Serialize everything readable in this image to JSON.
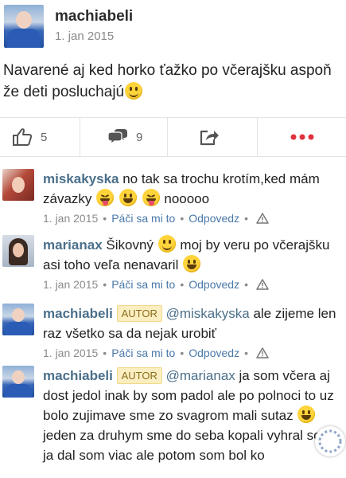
{
  "post": {
    "author": "machiabeli",
    "date": "1. jan 2015",
    "text": "Navarené aj ked horko ťažko po včerajšku aspoň že deti posluchajú"
  },
  "actions": {
    "like_count": "5",
    "comment_count": "9"
  },
  "comments": [
    {
      "author": "miskakyska",
      "text_1": "no tak sa trochu krotím,ked mám závazky",
      "text_2": "nooooo",
      "date": "1. jan 2015",
      "like_label": "Páči sa mi to",
      "reply_label": "Odpovedz"
    },
    {
      "author": "marianax",
      "text_1": "Šikovný",
      "text_2": "moj by veru po včerajšku asi toho veľa nenavaril",
      "date": "1. jan 2015",
      "like_label": "Páči sa mi to",
      "reply_label": "Odpovedz"
    },
    {
      "author": "machiabeli",
      "badge": "AUTOR",
      "mention": "@miskakyska",
      "text_1": "ale zijeme len raz všetko sa da nejak urobiť",
      "date": "1. jan 2015",
      "like_label": "Páči sa mi to",
      "reply_label": "Odpovedz"
    },
    {
      "author": "machiabeli",
      "badge": "AUTOR",
      "mention": "@marianax",
      "text_1": "ja som včera aj dost jedol inak by som padol ale po polnoci to uz bolo zujimave sme zo svagrom mali sutaz",
      "text_2": "jeden za druhym sme do seba kopali vyhral som ja dal som viac ale potom som bol ko"
    }
  ],
  "colors": {
    "link": "#4a78a8",
    "name": "#4a6f8a",
    "more_dots": "#e0323c",
    "badge_bg": "#fbeec1"
  }
}
